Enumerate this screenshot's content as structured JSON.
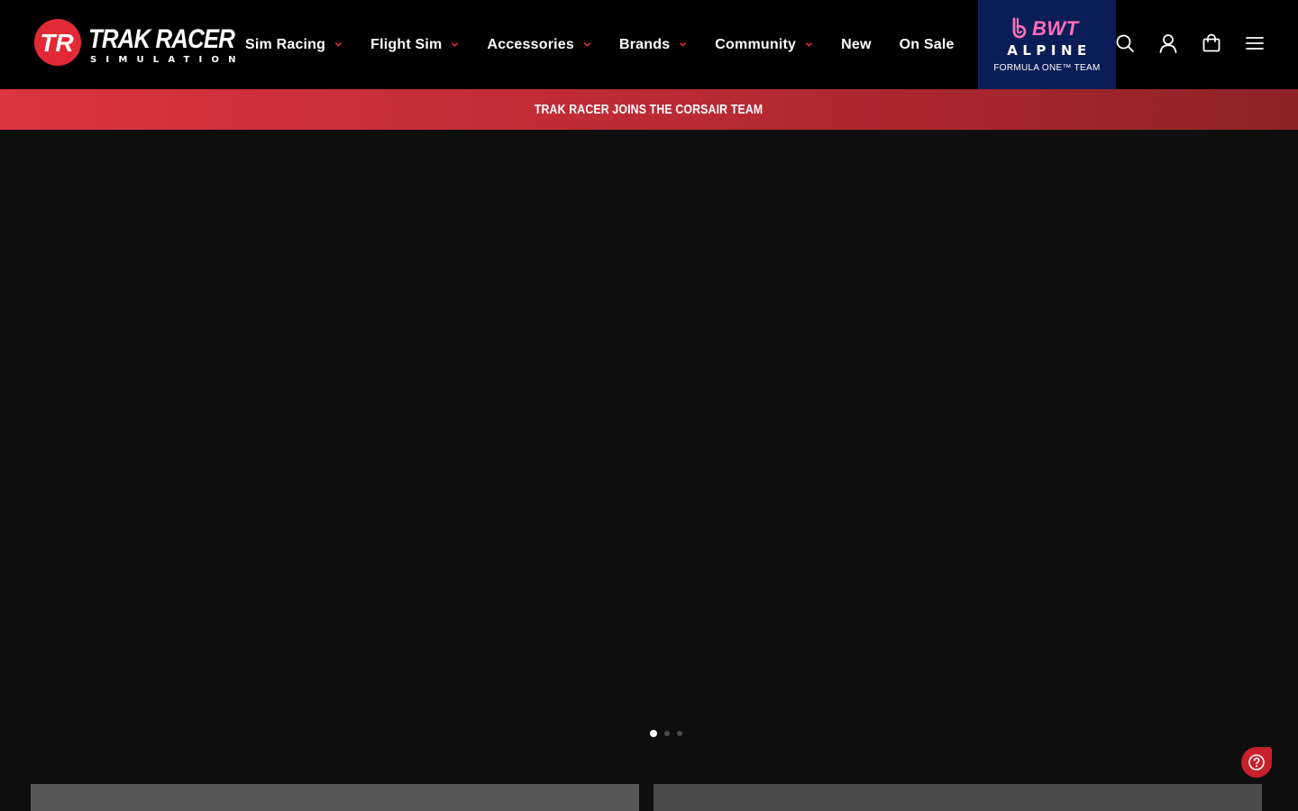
{
  "header": {
    "logo": {
      "wordmark": "TRAK RACER",
      "subtitle": "SIMULATION",
      "mark_letters": "TR",
      "mark_color": "#e12a36"
    },
    "nav": [
      {
        "label": "Sim Racing",
        "has_dropdown": true
      },
      {
        "label": "Flight Sim",
        "has_dropdown": true
      },
      {
        "label": "Accessories",
        "has_dropdown": true
      },
      {
        "label": "Brands",
        "has_dropdown": true
      },
      {
        "label": "Community",
        "has_dropdown": true
      },
      {
        "label": "New",
        "has_dropdown": false
      },
      {
        "label": "On Sale",
        "has_dropdown": false
      }
    ],
    "dropdown_icon": "chevron-down-icon",
    "dropdown_icon_color": "#e12a36",
    "partner": {
      "brand": "BWT",
      "team": "ALPINE",
      "tagline": "FORMULA ONE™ TEAM",
      "background": "#0b1d57",
      "accent": "#ff6fb7"
    },
    "actions": [
      {
        "icon": "search-icon"
      },
      {
        "icon": "account-icon"
      },
      {
        "icon": "cart-icon"
      },
      {
        "icon": "menu-icon"
      }
    ]
  },
  "announcement": {
    "text": "TRAK RACER JOINS THE CORSAIR TEAM",
    "gradient_start": "#dc3440",
    "gradient_end": "#8f2226"
  },
  "hero": {
    "slide_count": 3,
    "active_slide": 1
  },
  "help": {
    "icon": "help-icon",
    "color": "#c8202c"
  },
  "colors": {
    "background": "#0e0e0f",
    "header": "#000000",
    "text": "#ffffff"
  }
}
